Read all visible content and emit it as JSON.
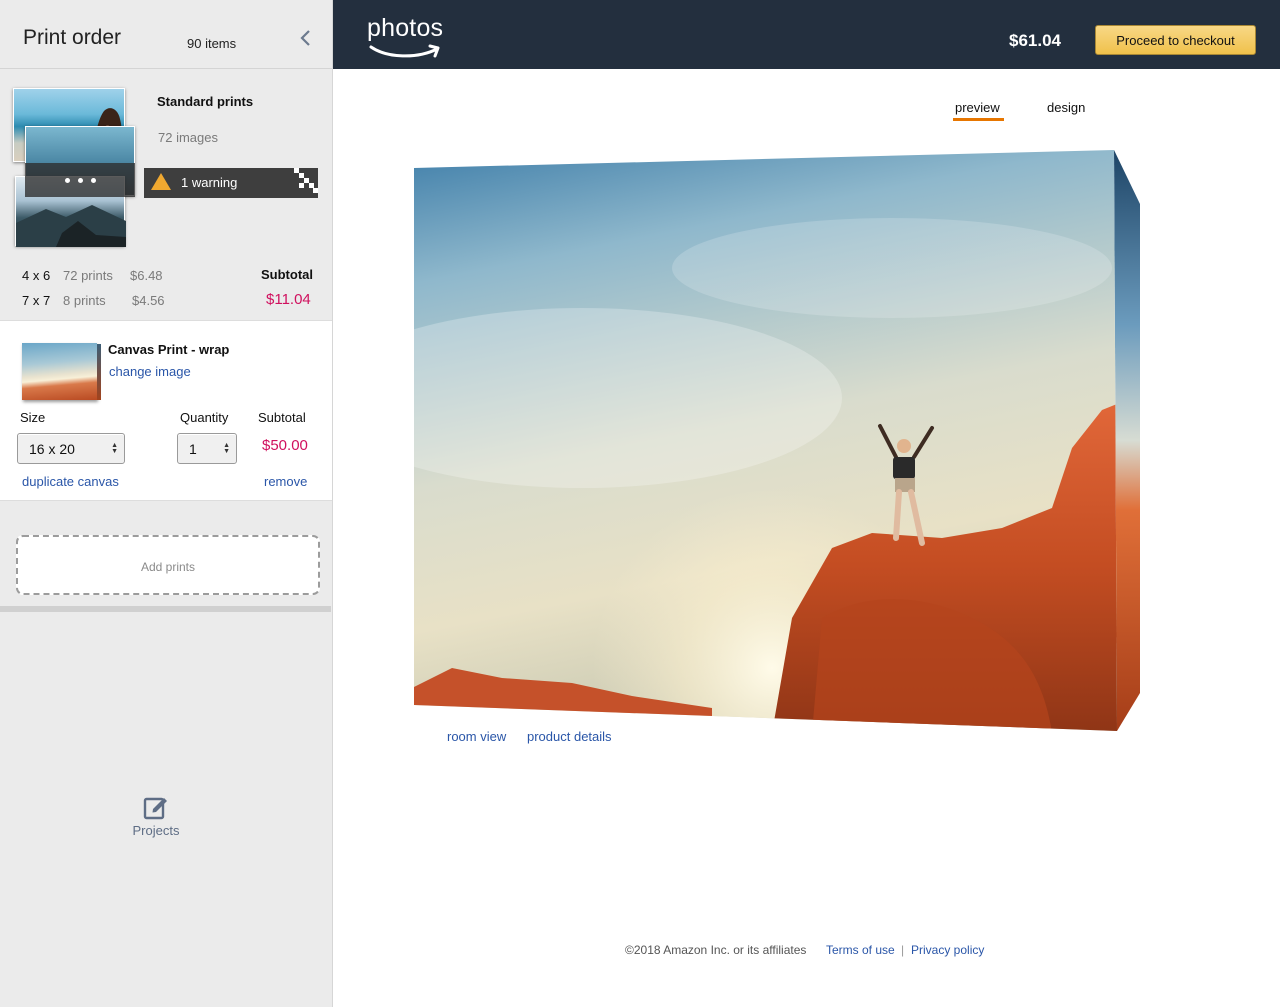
{
  "sidebar": {
    "title": "Print order",
    "item_count": "90 items",
    "standard_prints": {
      "label": "Standard prints",
      "images": "72 images",
      "warning": "1 warning",
      "sizes": [
        {
          "size": "4 x 6",
          "count": "72 prints",
          "price": "$6.48"
        },
        {
          "size": "7 x 7",
          "count": "8 prints",
          "price": "$4.56"
        }
      ],
      "subtotal_label": "Subtotal",
      "subtotal": "$11.04"
    },
    "canvas": {
      "name": "Canvas Print - wrap",
      "change_image": "change image",
      "size_label": "Size",
      "size_value": "16 x 20",
      "quantity_label": "Quantity",
      "quantity_value": "1",
      "subtotal_label": "Subtotal",
      "subtotal": "$50.00",
      "duplicate": "duplicate canvas",
      "remove": "remove"
    },
    "add_prints": "Add prints",
    "projects": "Projects"
  },
  "header": {
    "logo": "photos",
    "total": "$61.04",
    "checkout": "Proceed to checkout"
  },
  "tabs": [
    {
      "label": "preview",
      "active": true
    },
    {
      "label": "design",
      "active": false
    }
  ],
  "preview_links": {
    "room_view": "room view",
    "product_details": "product details"
  },
  "footer": {
    "copyright": "©2018 Amazon Inc. or its affiliates",
    "terms": "Terms of use",
    "separator": "|",
    "privacy": "Privacy policy"
  },
  "colors": {
    "header_bg": "#232f3e",
    "accent": "#e77600",
    "price": "#d0105e",
    "link": "#2a56a8",
    "button": "#f0c14b"
  }
}
